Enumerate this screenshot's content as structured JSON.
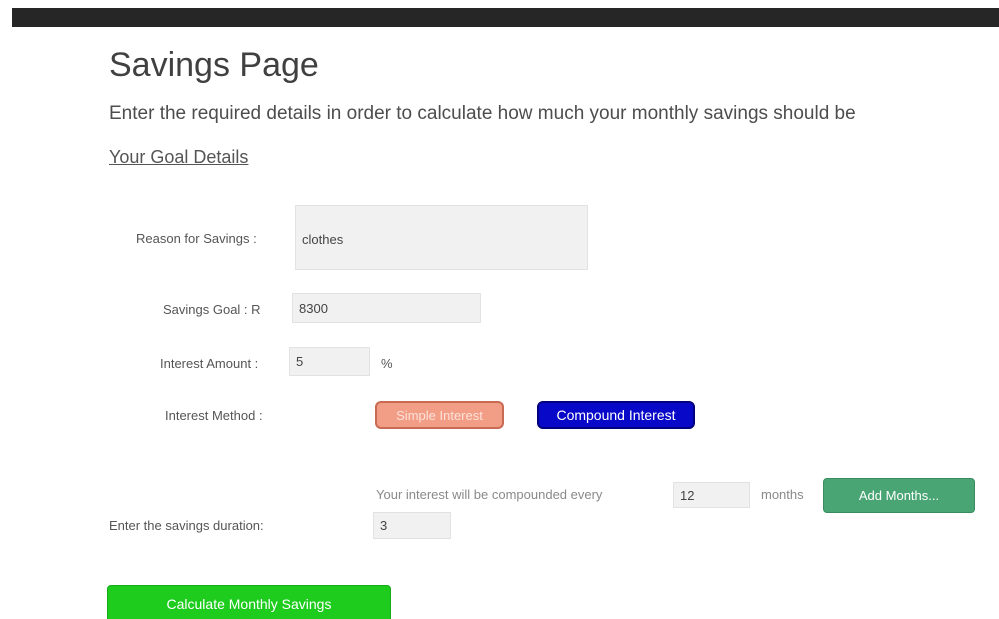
{
  "header": {
    "title": "Savings Page",
    "intro": "Enter the required details in order to calculate how much your monthly savings should be",
    "section_link": "Your Goal Details"
  },
  "form": {
    "reason_label": "Reason for Savings :",
    "reason_value": "clothes",
    "goal_label": "Savings Goal : R",
    "goal_value": "8300",
    "interest_label": "Interest Amount :",
    "interest_value": "5",
    "percent_sign": "%",
    "method_label": "Interest Method :",
    "simple_button": "Simple Interest",
    "compound_button": "Compound Interest",
    "compound_prefix": "Your interest will be compounded every",
    "compound_value": "12",
    "compound_suffix": "months",
    "add_months_button": "Add Months...",
    "duration_label": "Enter the savings duration:",
    "duration_value": "3",
    "calculate_button": "Calculate Monthly Savings"
  },
  "colors": {
    "top_bar": "#262626",
    "simple_button_bg": "#f29d86",
    "compound_button_bg": "#0808c8",
    "add_months_bg": "#4aa574",
    "calculate_bg": "#1ecc1e"
  }
}
